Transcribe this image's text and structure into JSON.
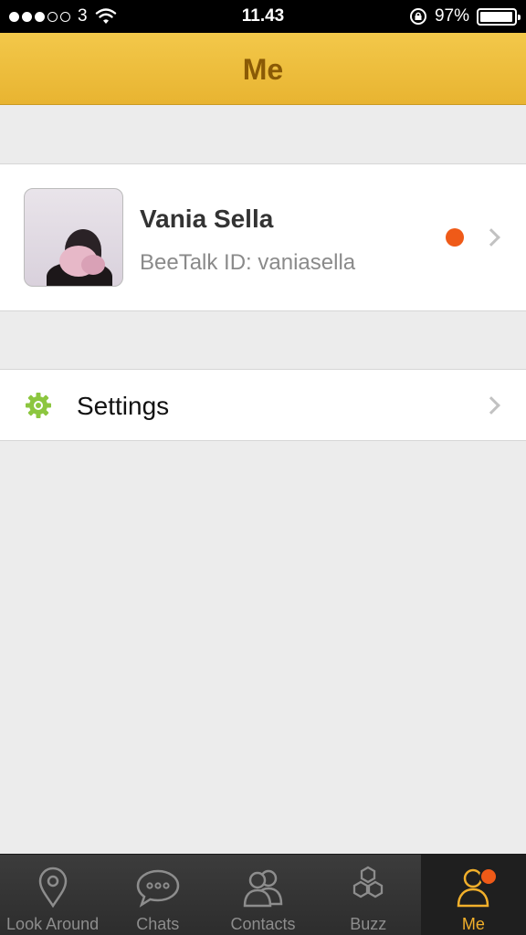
{
  "status_bar": {
    "carrier": "3",
    "signal_bars_filled": 3,
    "signal_bars_total": 5,
    "time": "11.43",
    "battery_percent": "97%",
    "battery_level": 0.97
  },
  "header": {
    "title": "Me"
  },
  "profile": {
    "name": "Vania Sella",
    "beetalk_id": "BeeTalk ID: vaniasella",
    "status_color": "#ef5a18"
  },
  "menu": {
    "settings_label": "Settings"
  },
  "tabs": [
    {
      "label": "Look Around",
      "icon": "location-pin-icon",
      "active": false
    },
    {
      "label": "Chats",
      "icon": "chat-bubble-icon",
      "active": false
    },
    {
      "label": "Contacts",
      "icon": "contacts-icon",
      "active": false
    },
    {
      "label": "Buzz",
      "icon": "honeycomb-icon",
      "active": false
    },
    {
      "label": "Me",
      "icon": "person-icon",
      "active": true
    }
  ],
  "colors": {
    "accent": "#f2b02b",
    "header": "#eebe3c",
    "badge": "#ef5a18",
    "settings_icon": "#8cc63f"
  }
}
